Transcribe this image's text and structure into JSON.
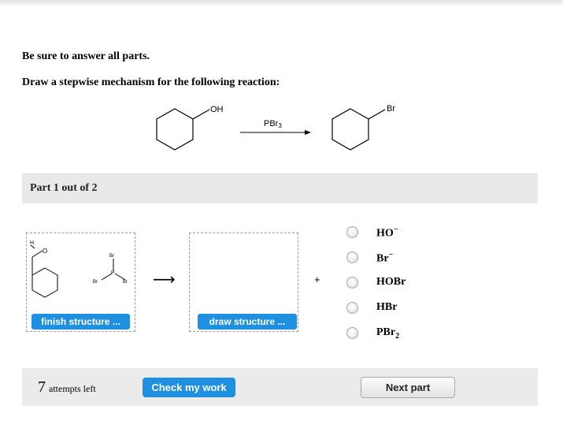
{
  "instructions": {
    "line1": "Be sure to answer all parts.",
    "line2": "Draw a stepwise mechanism for the following reaction:"
  },
  "reaction": {
    "reactant_group": "OH",
    "reagent": "PBr",
    "reagent_subscript": "3",
    "product_group": "Br"
  },
  "part": {
    "label": "Part 1 out of 2"
  },
  "draw_area": {
    "box1_labels": {
      "h": "H",
      "o": "O",
      "br_top": "Br",
      "p": "P",
      "br_left": "Br",
      "br_right": "Br"
    },
    "finish_button": "finish structure ...",
    "draw_button": "draw structure ...",
    "arrow": "⟶",
    "plus": "+"
  },
  "choices": [
    {
      "base": "HO",
      "sup": "−",
      "sub": ""
    },
    {
      "base": "Br",
      "sup": "−",
      "sub": ""
    },
    {
      "base": "HOBr",
      "sup": "",
      "sub": ""
    },
    {
      "base": "HBr",
      "sup": "",
      "sub": ""
    },
    {
      "base": "PBr",
      "sup": "",
      "sub": "2"
    }
  ],
  "footer": {
    "attempts_count": "7",
    "attempts_label": "attempts left",
    "check_button": "Check my work",
    "next_button": "Next part"
  }
}
